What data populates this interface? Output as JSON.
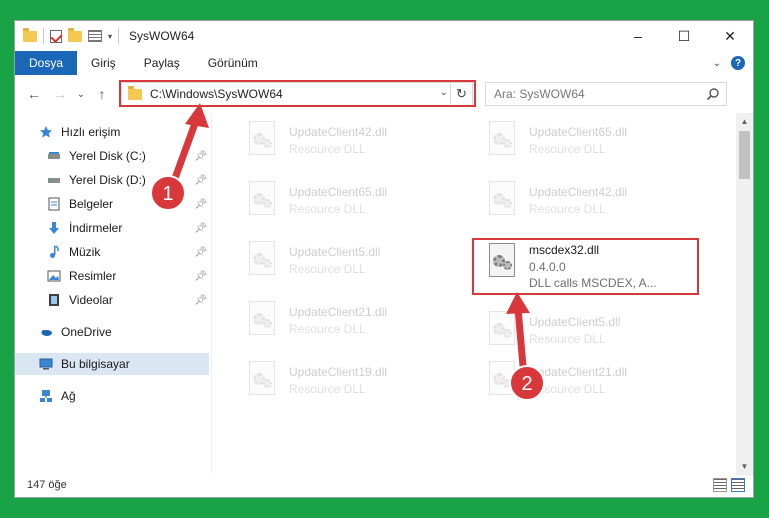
{
  "window": {
    "title": "SysWOW64"
  },
  "controls": {
    "minimize": "–",
    "maximize": "☐",
    "close": "✕"
  },
  "ribbon": {
    "tabs": [
      {
        "label": "Dosya"
      },
      {
        "label": "Giriş"
      },
      {
        "label": "Paylaş"
      },
      {
        "label": "Görünüm"
      }
    ],
    "help": "?"
  },
  "nav": {
    "back": "←",
    "forward": "→",
    "recent": "⌄",
    "up": "↑",
    "address": "C:\\Windows\\SysWOW64",
    "refresh": "↻",
    "search_placeholder": "Ara: SysWOW64"
  },
  "sidebar": {
    "items": [
      {
        "label": "Hızlı erişim",
        "icon": "star-icon"
      },
      {
        "label": "Yerel Disk (C:)",
        "icon": "drive-icon",
        "pinned": true
      },
      {
        "label": "Yerel Disk (D:)",
        "icon": "drive-icon",
        "pinned": true
      },
      {
        "label": "Belgeler",
        "icon": "documents-icon",
        "pinned": true
      },
      {
        "label": "İndirmeler",
        "icon": "download-icon",
        "pinned": true
      },
      {
        "label": "Müzik",
        "icon": "music-icon",
        "pinned": true
      },
      {
        "label": "Resimler",
        "icon": "pictures-icon",
        "pinned": true
      },
      {
        "label": "Videolar",
        "icon": "videos-icon",
        "pinned": true
      },
      {
        "label": "OneDrive",
        "icon": "cloud-icon"
      },
      {
        "label": "Bu bilgisayar",
        "icon": "computer-icon",
        "selected": true
      },
      {
        "label": "Ağ",
        "icon": "network-icon"
      }
    ]
  },
  "files": [
    {
      "name": "UpdateClient42.dll",
      "sub": "Resource DLL"
    },
    {
      "name": "UpdateClient65.dll",
      "sub": "Resource DLL"
    },
    {
      "name": "UpdateClient65.dll",
      "sub": "Resource DLL"
    },
    {
      "name": "UpdateClient42.dll",
      "sub": "Resource DLL"
    },
    {
      "name": "UpdateClient5.dll",
      "sub": "Resource DLL"
    },
    {
      "name": "mscdex32.dll",
      "sub": "0.4.0.0",
      "sub2": "DLL calls MSCDEX, A..."
    },
    {
      "name": "UpdateClient21.dll",
      "sub": "Resource DLL"
    },
    {
      "name": "UpdateClient5.dll",
      "sub": "Resource DLL"
    },
    {
      "name": "UpdateClient19.dll",
      "sub": "Resource DLL"
    },
    {
      "name": "UpdateClient21.dll",
      "sub": "Resource DLL"
    }
  ],
  "status": {
    "count": "147 öğe"
  },
  "annotations": {
    "step1": "1",
    "step2": "2",
    "color": "#d9383a"
  }
}
